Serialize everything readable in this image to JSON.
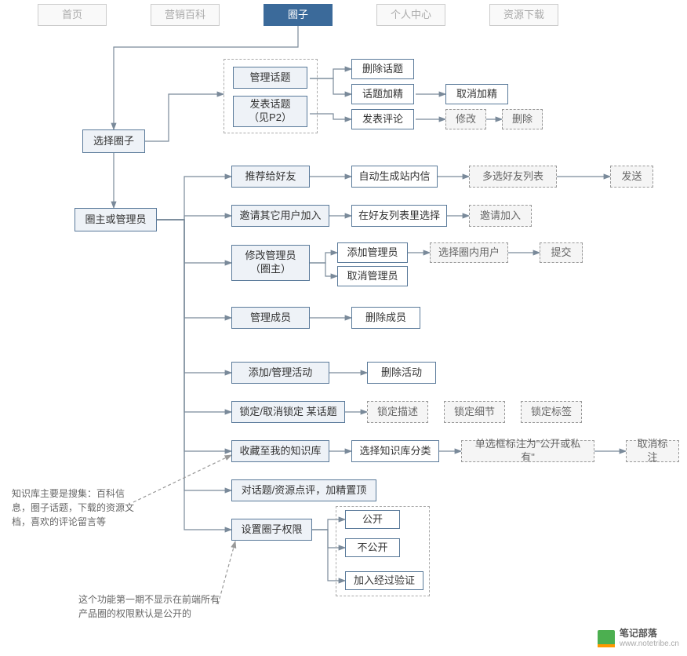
{
  "nav": {
    "home": "首页",
    "wiki": "营销百科",
    "circle": "圈子",
    "profile": "个人中心",
    "download": "资源下载"
  },
  "nodes": {
    "selectCircle": "选择圈子",
    "ownerOrAdmin": "圈主或管理员",
    "manageTopic": "管理话题",
    "postTopic": "发表话题（见P2）",
    "deleteTopic": "删除话题",
    "featureTopic": "话题加精",
    "unfeature": "取消加精",
    "postComment": "发表评论",
    "edit": "修改",
    "delete": "删除",
    "recommendFriend": "推荐给好友",
    "autoGenMsg": "自动生成站内信",
    "multiSelectFriends": "多选好友列表",
    "send": "发送",
    "inviteOthers": "邀请其它用户加入",
    "selectFromFriends": "在好友列表里选择",
    "inviteJoin": "邀请加入",
    "modifyAdmin": "修改管理员（圈主）",
    "addAdmin": "添加管理员",
    "cancelAdmin": "取消管理员",
    "selectCircleUser": "选择圈内用户",
    "submit": "提交",
    "manageMembers": "管理成员",
    "deleteMember": "删除成员",
    "addManageActivity": "添加/管理活动",
    "deleteActivity": "删除活动",
    "lockUnlock": "锁定/取消锁定 某话题",
    "lockDesc": "锁定描述",
    "lockDetail": "锁定细节",
    "lockTag": "锁定标签",
    "favoriteKB": "收藏至我的知识库",
    "selectKBCategory": "选择知识库分类",
    "radioMark": "单选框标注为\"公开或私有\"",
    "cancelMark": "取消标注",
    "reviewTopic": "对话题/资源点评，加精置顶",
    "setCirclePermission": "设置圈子权限",
    "public": "公开",
    "private": "不公开",
    "joinVerified": "加入经过验证"
  },
  "notes": {
    "kbNote": "知识库主要是搜集：百科信息，圈子话题，下载的资源文档，喜欢的评论留言等",
    "permNote": "这个功能第一期不显示在前端所有产品圈的权限默认是公开的"
  },
  "watermark": {
    "text": "笔记部落",
    "url": "www.notetribe.cn"
  }
}
